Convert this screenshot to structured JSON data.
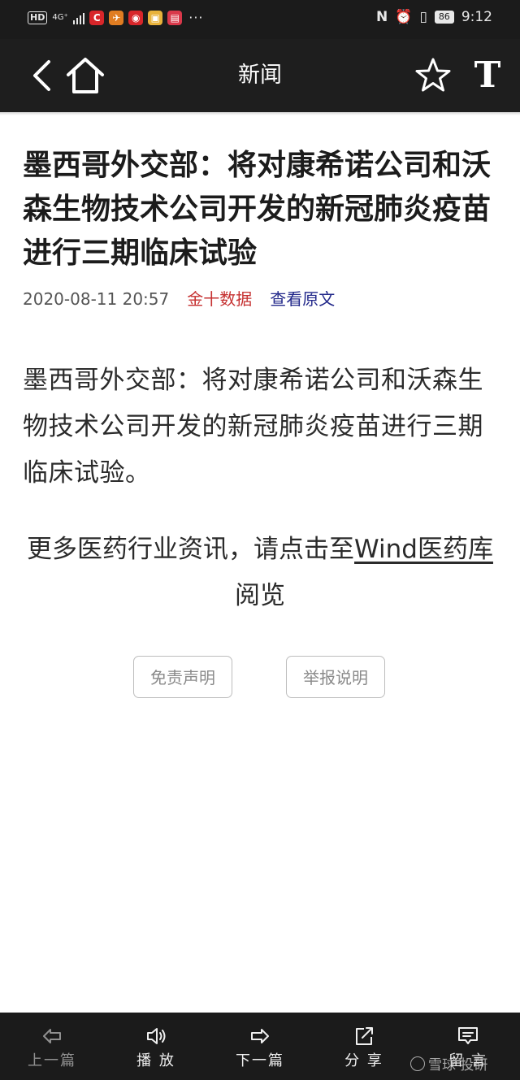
{
  "status_bar": {
    "left_badge": "HD",
    "network": "4G⁺",
    "time": "9:12",
    "battery": "86"
  },
  "nav": {
    "title": "新闻",
    "font_icon_label": "T"
  },
  "article": {
    "headline": "墨西哥外交部：将对康希诺公司和沃森生物技术公司开发的新冠肺炎疫苗进行三期临床试验",
    "date": "2020-08-11 20:57",
    "source": "金十数据",
    "view_original": "查看原文",
    "body": "墨西哥外交部：将对康希诺公司和沃森生物技术公司开发的新冠肺炎疫苗进行三期临床试验。",
    "more_prefix": "更多医药行业资讯，请点击至",
    "more_link": "Wind医药库",
    "more_suffix": "阅览",
    "disclaimer_button": "免责声明",
    "report_button": "举报说明"
  },
  "bottom_bar": {
    "items": [
      {
        "label": "上一篇",
        "icon": "back-arrow-icon"
      },
      {
        "label": "播 放",
        "icon": "speaker-icon"
      },
      {
        "label": "下一篇",
        "icon": "forward-arrow-icon"
      },
      {
        "label": "分 享",
        "icon": "share-icon"
      },
      {
        "label": "留 言",
        "icon": "comment-icon"
      }
    ]
  },
  "watermark": "雪球 投研",
  "colors": {
    "bar_background": "#1b1b1b",
    "source_red": "#c63232",
    "link_blue": "#22288a"
  }
}
